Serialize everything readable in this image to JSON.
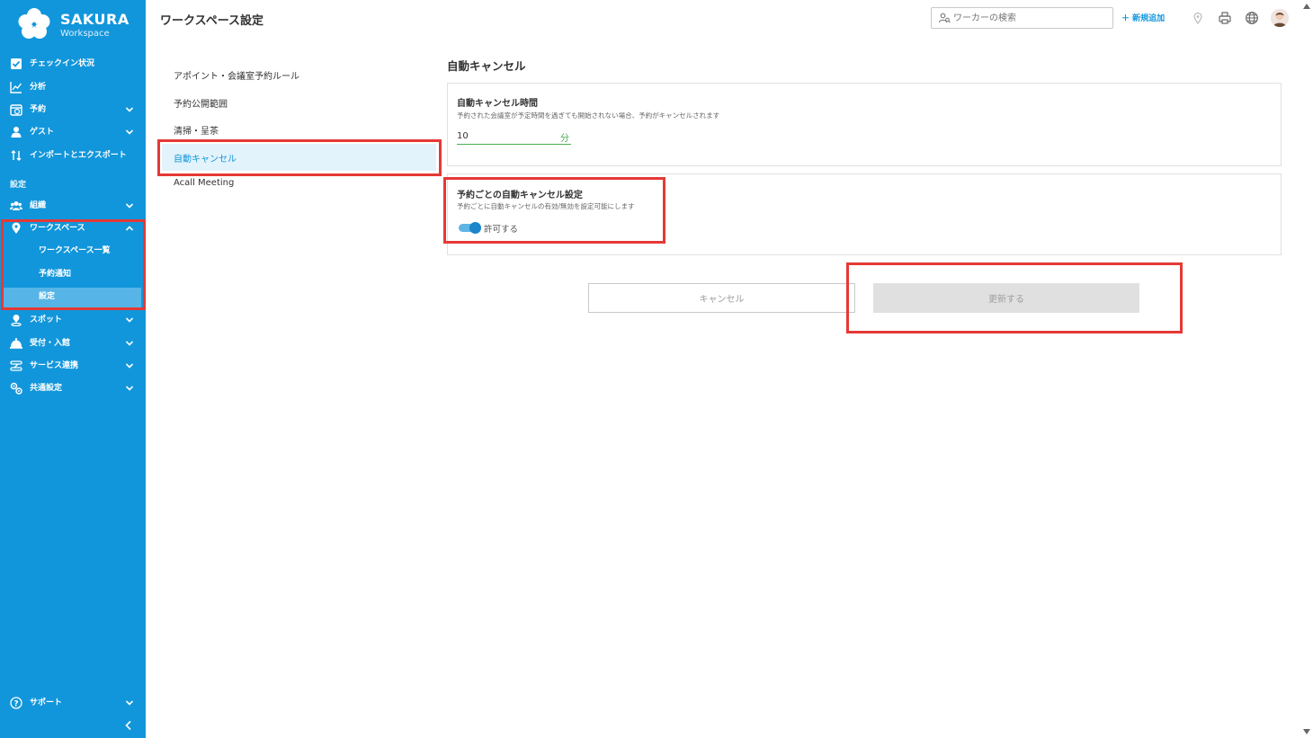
{
  "brand": {
    "name": "SAKURA",
    "sub": "Workspace"
  },
  "sidebar": {
    "items": [
      {
        "label": "チェックイン状況",
        "icon": "checkbox-icon"
      },
      {
        "label": "分析",
        "icon": "chart-icon"
      },
      {
        "label": "予約",
        "icon": "calendar-icon"
      },
      {
        "label": "ゲスト",
        "icon": "guest-icon"
      },
      {
        "label": "インポートとエクスポート",
        "icon": "import-export-icon"
      }
    ],
    "section_label": "設定",
    "settings_items": [
      {
        "label": "組織",
        "icon": "organization-icon"
      },
      {
        "label": "ワークスペース",
        "icon": "location-pin-icon"
      }
    ],
    "workspace_sub": [
      {
        "label": "ワークスペース一覧"
      },
      {
        "label": "予約通知"
      },
      {
        "label": "設定"
      }
    ],
    "more_items": [
      {
        "label": "スポット",
        "icon": "spot-icon"
      },
      {
        "label": "受付・入館",
        "icon": "reception-icon"
      },
      {
        "label": "サービス連携",
        "icon": "service-link-icon"
      },
      {
        "label": "共通設定",
        "icon": "common-settings-icon"
      }
    ],
    "support_label": "サポート"
  },
  "header": {
    "title": "ワークスペース設定",
    "search_placeholder": "ワーカーの検索",
    "add_new": "新規追加"
  },
  "settings_menu": [
    "アポイント・会議室予約ルール",
    "予約公開範囲",
    "清掃・呈茶",
    "自動キャンセル",
    "Acall Meeting"
  ],
  "content": {
    "title": "自動キャンセル",
    "auto_cancel_time": {
      "title": "自動キャンセル時間",
      "desc": "予約された会議室が予定時間を過ぎても開始されない場合、予約がキャンセルされます",
      "value": "10",
      "unit": "分"
    },
    "per_reservation": {
      "title": "予約ごとの自動キャンセル設定",
      "desc": "予約ごとに自動キャンセルの有効/無効を設定可能にします",
      "toggle_label": "許可する",
      "enabled": true
    },
    "buttons": {
      "cancel": "キャンセル",
      "update": "更新する"
    }
  },
  "colors": {
    "sidebar": "#1296db",
    "accent": "#1296db",
    "highlight": "#e53935",
    "input_accent": "#4caf50"
  }
}
